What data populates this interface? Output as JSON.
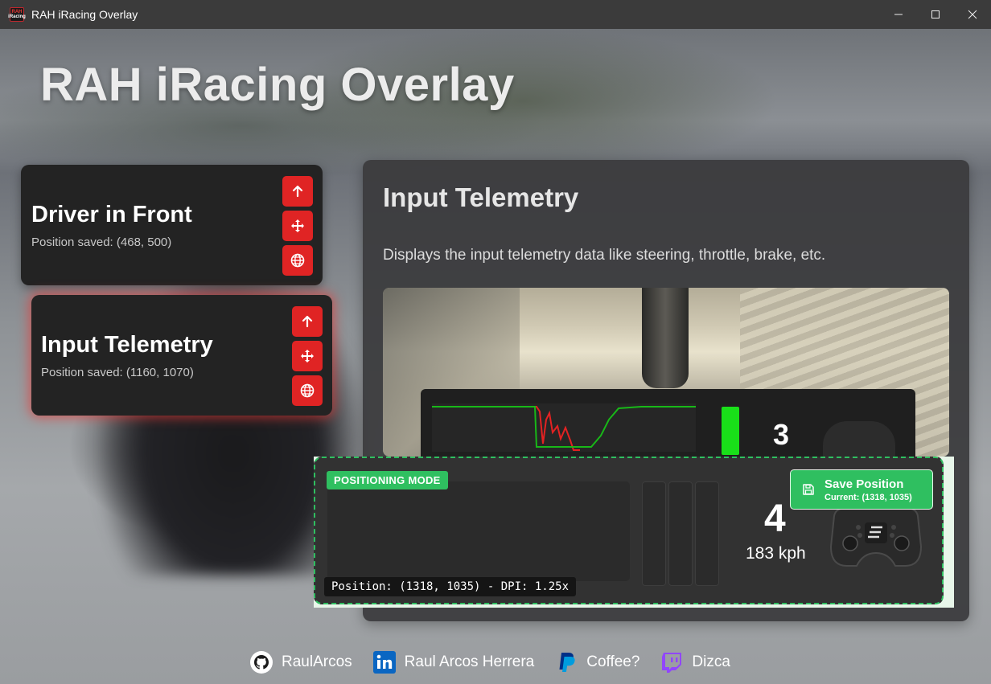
{
  "window": {
    "title": "RAH iRacing Overlay",
    "icon_text_top": "RAH",
    "icon_text_bottom": "iRacing"
  },
  "header": {
    "title": "RAH iRacing Overlay"
  },
  "overlays": [
    {
      "title": "Driver in Front",
      "status": "Position saved: (468, 500)"
    },
    {
      "title": "Input Telemetry",
      "status": "Position saved: (1160, 1070)",
      "selected": true
    }
  ],
  "detail": {
    "title": "Input Telemetry",
    "description": "Displays the input telemetry data like steering, throttle, brake, etc.",
    "preview_gear": "3"
  },
  "positioning": {
    "badge": "POSITIONING MODE",
    "gear": "4",
    "speed": "183 kph",
    "readout": "Position: (1318, 1035) - DPI: 1.25x",
    "save_label": "Save Position",
    "save_sub": "Current: (1318, 1035)"
  },
  "footer": {
    "links": [
      {
        "label": "RaulArcos",
        "icon": "github-icon"
      },
      {
        "label": "Raul Arcos Herrera",
        "icon": "linkedin-icon"
      },
      {
        "label": "Coffee?",
        "icon": "paypal-icon"
      },
      {
        "label": "Dizca",
        "icon": "twitch-icon"
      }
    ]
  },
  "colors": {
    "accent_red": "#e02424",
    "accent_green": "#2fbf60",
    "card_bg": "#232323"
  }
}
